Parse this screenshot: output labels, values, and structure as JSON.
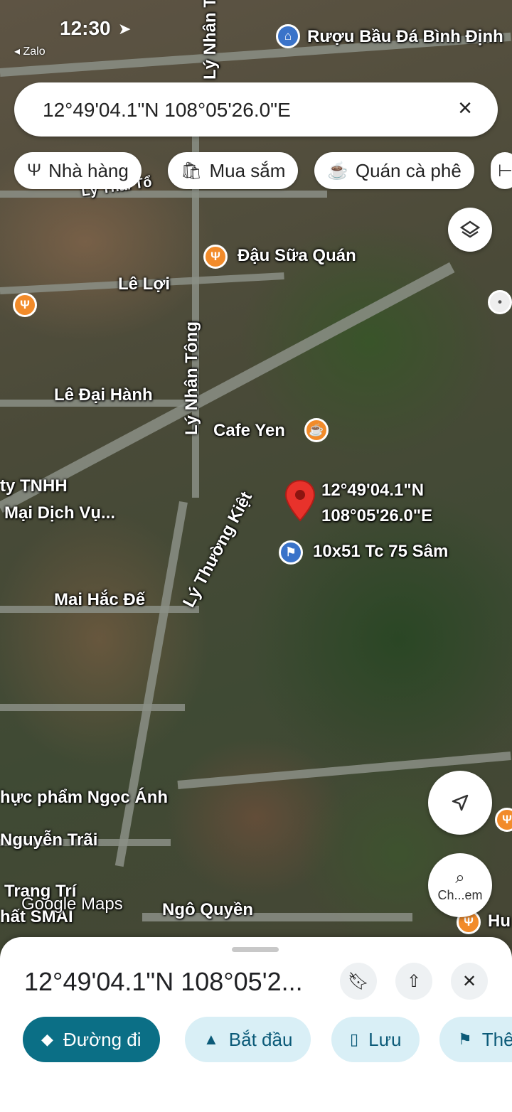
{
  "status_bar": {
    "time": "12:30",
    "back_app": "◂ Zalo"
  },
  "search": {
    "query": "12°49'04.1\"N 108°05'26.0\"E"
  },
  "chips": [
    {
      "icon": "restaurant-icon",
      "label": "Nhà hàng"
    },
    {
      "icon": "shopping-icon",
      "label": "Mua sắm"
    },
    {
      "icon": "coffee-icon",
      "label": "Quán cà phê"
    }
  ],
  "map": {
    "streets": [
      "Lý Nhân Tông",
      "Lý Nhân Tông",
      "Lê Lợi",
      "Lê Đại Hành",
      "Lý Thường Kiệt",
      "Mai Hắc Đế",
      "Nguyễn Trãi",
      "Ngô Quyền",
      "Lý Thái Tổ"
    ],
    "places": [
      "Rượu Bầu Đá Bình Định",
      "Đậu Sữa Quán",
      "Cafe Yen",
      "10x51 Tc 75 Sâm",
      "ty TNHH",
      "Mại Dịch Vụ...",
      "hực phẩm Ngọc Ánh",
      "Trang Trí",
      "hất SMAI",
      "Hu"
    ],
    "pin_lat": "12°49'04.1\"N",
    "pin_lng": "108°05'26.0\"E",
    "watermark": "Google Maps"
  },
  "controls": {
    "lens_label": "Ch...em"
  },
  "sheet": {
    "title": "12°49'04.1\"N 108°05'2...",
    "actions": [
      {
        "icon": "directions-icon",
        "label": "Đường đi"
      },
      {
        "icon": "navigation-icon",
        "label": "Bắt đầu"
      },
      {
        "icon": "bookmark-icon",
        "label": "Lưu"
      },
      {
        "icon": "flag-icon",
        "label": "Thê"
      }
    ]
  }
}
